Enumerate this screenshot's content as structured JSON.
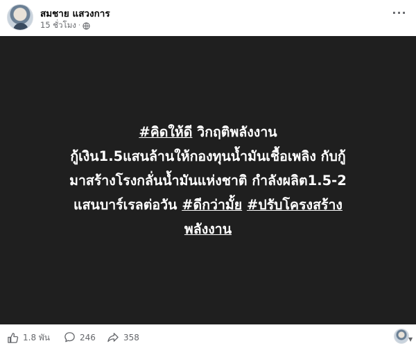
{
  "post": {
    "author": "สมชาย แสวงการ",
    "time": "15 ชั่วโมง",
    "separator": "·",
    "privacy_icon": "globe-icon",
    "more_icon": "more-options-icon",
    "more_label": "···"
  },
  "image_text": {
    "tag1": "#คิดให้ดี",
    "line1_rest": " วิกฤติพลังงาน",
    "line2": "กู้เงิน1.5แสนล้านให้กองทุนน้ำมันเชื้อเพลิง กับกู้",
    "line3": "มาสร้างโรงกลั่นน้ำมันแห่งชาติ กำลังผลิต1.5-2",
    "line4_start": "แสนบาร์เรลต่อวัน ",
    "tag2": "#ดีกว่ามั้ย",
    "tag3": "#ปรับโครงสร้าง",
    "tag3_cont": "พลังงาน",
    "background": "#1f1f1f",
    "text_color": "#ffffff"
  },
  "footer": {
    "likes": "1.8 พัน",
    "comments": "246",
    "shares": "358"
  }
}
